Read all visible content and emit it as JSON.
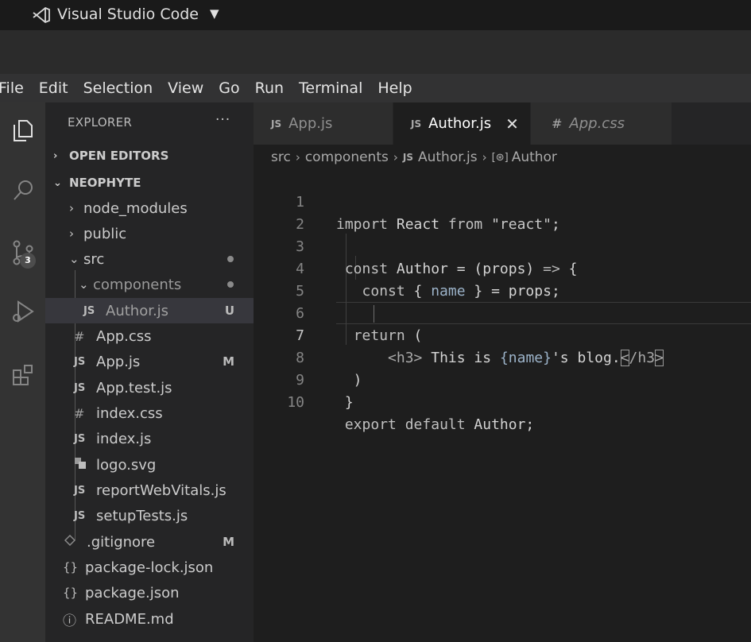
{
  "os_bar": {
    "app_name": "Visual Studio Code",
    "caret": "▼"
  },
  "menubar": [
    "File",
    "Edit",
    "Selection",
    "View",
    "Go",
    "Run",
    "Terminal",
    "Help"
  ],
  "activity_bar": {
    "items": [
      "files-icon",
      "search-icon",
      "source-control-icon",
      "run-debug-icon",
      "extensions-icon"
    ],
    "scm_badge": "3"
  },
  "explorer": {
    "title": "EXPLORER",
    "more": "···",
    "open_editors": "OPEN EDITORS",
    "project": "NEOPHYTE",
    "tree": [
      {
        "label": "node_modules",
        "type": "folder",
        "chevron": "›"
      },
      {
        "label": "public",
        "type": "folder",
        "chevron": "›"
      },
      {
        "label": "src",
        "type": "folder",
        "chevron": "⌄"
      },
      {
        "label": "components",
        "type": "folder",
        "chevron": "⌄"
      },
      {
        "label": "Author.js",
        "icon": "JS",
        "badge": "U"
      },
      {
        "label": "App.css",
        "icon": "#"
      },
      {
        "label": "App.js",
        "icon": "JS",
        "badge": "M"
      },
      {
        "label": "App.test.js",
        "icon": "JS"
      },
      {
        "label": "index.css",
        "icon": "#"
      },
      {
        "label": "index.js",
        "icon": "JS"
      },
      {
        "label": "logo.svg",
        "icon": "image-icon"
      },
      {
        "label": "reportWebVitals.js",
        "icon": "JS"
      },
      {
        "label": "setupTests.js",
        "icon": "JS"
      },
      {
        "label": ".gitignore",
        "icon": "git-icon",
        "badge": "M"
      },
      {
        "label": "package-lock.json",
        "icon": "{}"
      },
      {
        "label": "package.json",
        "icon": "{}"
      },
      {
        "label": "README.md",
        "icon": "ⓘ"
      }
    ]
  },
  "tabs": [
    {
      "label": "App.js",
      "icon": "JS"
    },
    {
      "label": "Author.js",
      "icon": "JS",
      "active": true,
      "close": "✕"
    },
    {
      "label": "App.css",
      "icon": "#"
    }
  ],
  "breadcrumb": [
    "src",
    "components",
    "Author.js",
    "Author"
  ],
  "breadcrumb_icons": {
    "js": "JS",
    "symbol": "[⊛]"
  },
  "editor": {
    "line_numbers": [
      "1",
      "2",
      "3",
      "4",
      "5",
      "6",
      "7",
      "8",
      "9",
      "10"
    ],
    "current_line": "7",
    "lines": [
      "import React from \"react\";",
      "",
      " const Author = (props) => {",
      "   const { name } = props;",
      "",
      "  return (",
      "      <h3> This is {name}'s blog.</h3>",
      "  )",
      " }",
      " export default Author;"
    ]
  }
}
